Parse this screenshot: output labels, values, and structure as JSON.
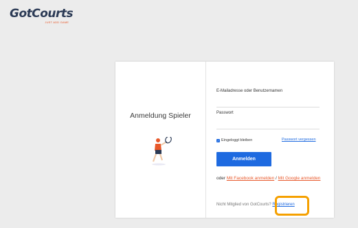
{
  "logo": {
    "name": "GotCourts",
    "tagline": "JUST ADD GAME"
  },
  "card": {
    "title": "Anmeldung Spieler",
    "email_label": "E-Mailadresse oder Benutzernamen",
    "password_label": "Passwort",
    "remember_label": "Eingeloggt bleiben",
    "remember_checked": true,
    "forgot_link": "Passwort vergessen",
    "login_button": "Anmelden",
    "social_prefix": "oder",
    "facebook_link": "Mit Facebook anmelden",
    "social_separator": "/",
    "google_link": "Mit Google anmelden",
    "not_member_text": "Nicht Mitglied von GotCourts?",
    "register_link": "Registrieren"
  },
  "colors": {
    "accent": "#1e6ae0",
    "brand": "#2b3a55",
    "orange": "#e8582a",
    "highlight": "#f5a000"
  },
  "icons": {
    "checkbox": "check-icon",
    "illustration": "tennis-player-illustration"
  }
}
